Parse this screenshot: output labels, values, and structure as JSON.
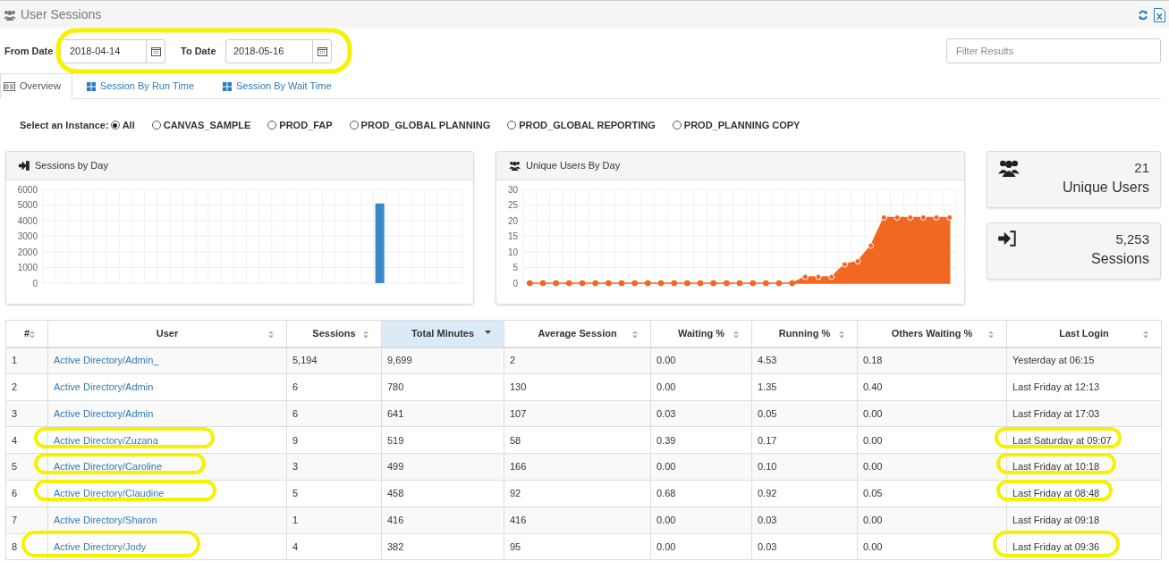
{
  "header": {
    "title": "User Sessions"
  },
  "filters": {
    "from_label": "From Date",
    "from_value": "2018-04-14",
    "to_label": "To Date",
    "to_value": "2018-05-16",
    "search_placeholder": "Filter Results"
  },
  "tabs": [
    {
      "label": "Overview",
      "kind": "overview",
      "selected": true
    },
    {
      "label": "Session By Run Time",
      "kind": "grid",
      "selected": false
    },
    {
      "label": "Session By Wait Time",
      "kind": "grid",
      "selected": false
    }
  ],
  "instance_label": "Select an Instance:",
  "instances": [
    {
      "label": "All",
      "selected": true
    },
    {
      "label": "CANVAS_SAMPLE",
      "selected": false
    },
    {
      "label": "PROD_FAP",
      "selected": false
    },
    {
      "label": "PROD_GLOBAL PLANNING",
      "selected": false
    },
    {
      "label": "PROD_GLOBAL REPORTING",
      "selected": false
    },
    {
      "label": "PROD_PLANNING COPY",
      "selected": false
    }
  ],
  "panels": [
    {
      "title": "Sessions by Day",
      "chart_data": {
        "type": "bar",
        "grid": true,
        "ylim": [
          0,
          6000
        ],
        "yticks": [
          0,
          1000,
          2000,
          3000,
          4000,
          5000,
          6000
        ],
        "series": [
          {
            "color": "#3a87c8",
            "values": [
              0,
              0,
              0,
              0,
              0,
              0,
              0,
              0,
              0,
              0,
              0,
              0,
              0,
              0,
              0,
              0,
              0,
              0,
              0,
              0,
              0,
              0,
              0,
              0,
              0,
              0,
              5100,
              0,
              0,
              0,
              0,
              0,
              0
            ]
          }
        ]
      }
    },
    {
      "title": "Unique Users By Day",
      "chart_data": {
        "type": "area",
        "grid": true,
        "ylim": [
          0,
          30
        ],
        "yticks": [
          0,
          5,
          10,
          15,
          20,
          25,
          30
        ],
        "series": [
          {
            "color": "#f26722",
            "values": [
              0,
              0,
              0,
              0,
              0,
              0,
              0,
              0,
              0,
              0,
              0,
              0,
              0,
              0,
              0,
              0,
              0,
              0,
              0,
              0,
              0,
              2,
              2,
              2,
              6,
              7,
              12,
              21,
              21,
              21,
              21,
              21,
              21
            ]
          }
        ]
      }
    }
  ],
  "stats": [
    {
      "kind": "users",
      "value": "21",
      "label": "Unique Users"
    },
    {
      "kind": "sessions",
      "value": "5,253",
      "label": "Sessions"
    }
  ],
  "table": {
    "columns": [
      {
        "label": "#",
        "sorted": false
      },
      {
        "label": "User",
        "sorted": false
      },
      {
        "label": "Sessions",
        "sorted": false
      },
      {
        "label": "Total Minutes",
        "sorted": true
      },
      {
        "label": "Average Session",
        "sorted": false
      },
      {
        "label": "Waiting %",
        "sorted": false
      },
      {
        "label": "Running %",
        "sorted": false
      },
      {
        "label": "Others Waiting %",
        "sorted": false
      },
      {
        "label": "Last Login",
        "sorted": false
      }
    ],
    "rows": [
      [
        "1",
        "Active Directory/Admin_",
        "5,194",
        "9,699",
        "2",
        "0.00",
        "4.53",
        "0.18",
        "Yesterday at 06:15"
      ],
      [
        "2",
        "Active Directory/Admin",
        "6",
        "780",
        "130",
        "0.00",
        "1.35",
        "0.40",
        "Last Friday at 12:13"
      ],
      [
        "3",
        "Active Directory/Admin",
        "6",
        "641",
        "107",
        "0.03",
        "0.05",
        "0.00",
        "Last Friday at 17:03"
      ],
      [
        "4",
        "Active Directory/Zuzana",
        "9",
        "519",
        "58",
        "0.39",
        "0.17",
        "0.00",
        "Last Saturday at 09:07"
      ],
      [
        "5",
        "Active Directory/Caroline",
        "3",
        "499",
        "166",
        "0.00",
        "0.10",
        "0.00",
        "Last Friday at 10:18"
      ],
      [
        "6",
        "Active Directory/Claudine",
        "5",
        "458",
        "92",
        "0.68",
        "0.92",
        "0.05",
        "Last Friday at 08:48"
      ],
      [
        "7",
        "Active Directory/Sharon",
        "1",
        "416",
        "416",
        "0.00",
        "0.03",
        "0.00",
        "Last Friday at 09:18"
      ],
      [
        "8",
        "Active Directory/Jody",
        "4",
        "382",
        "95",
        "0.00",
        "0.03",
        "0.00",
        "Last Friday at 09:36"
      ]
    ]
  }
}
